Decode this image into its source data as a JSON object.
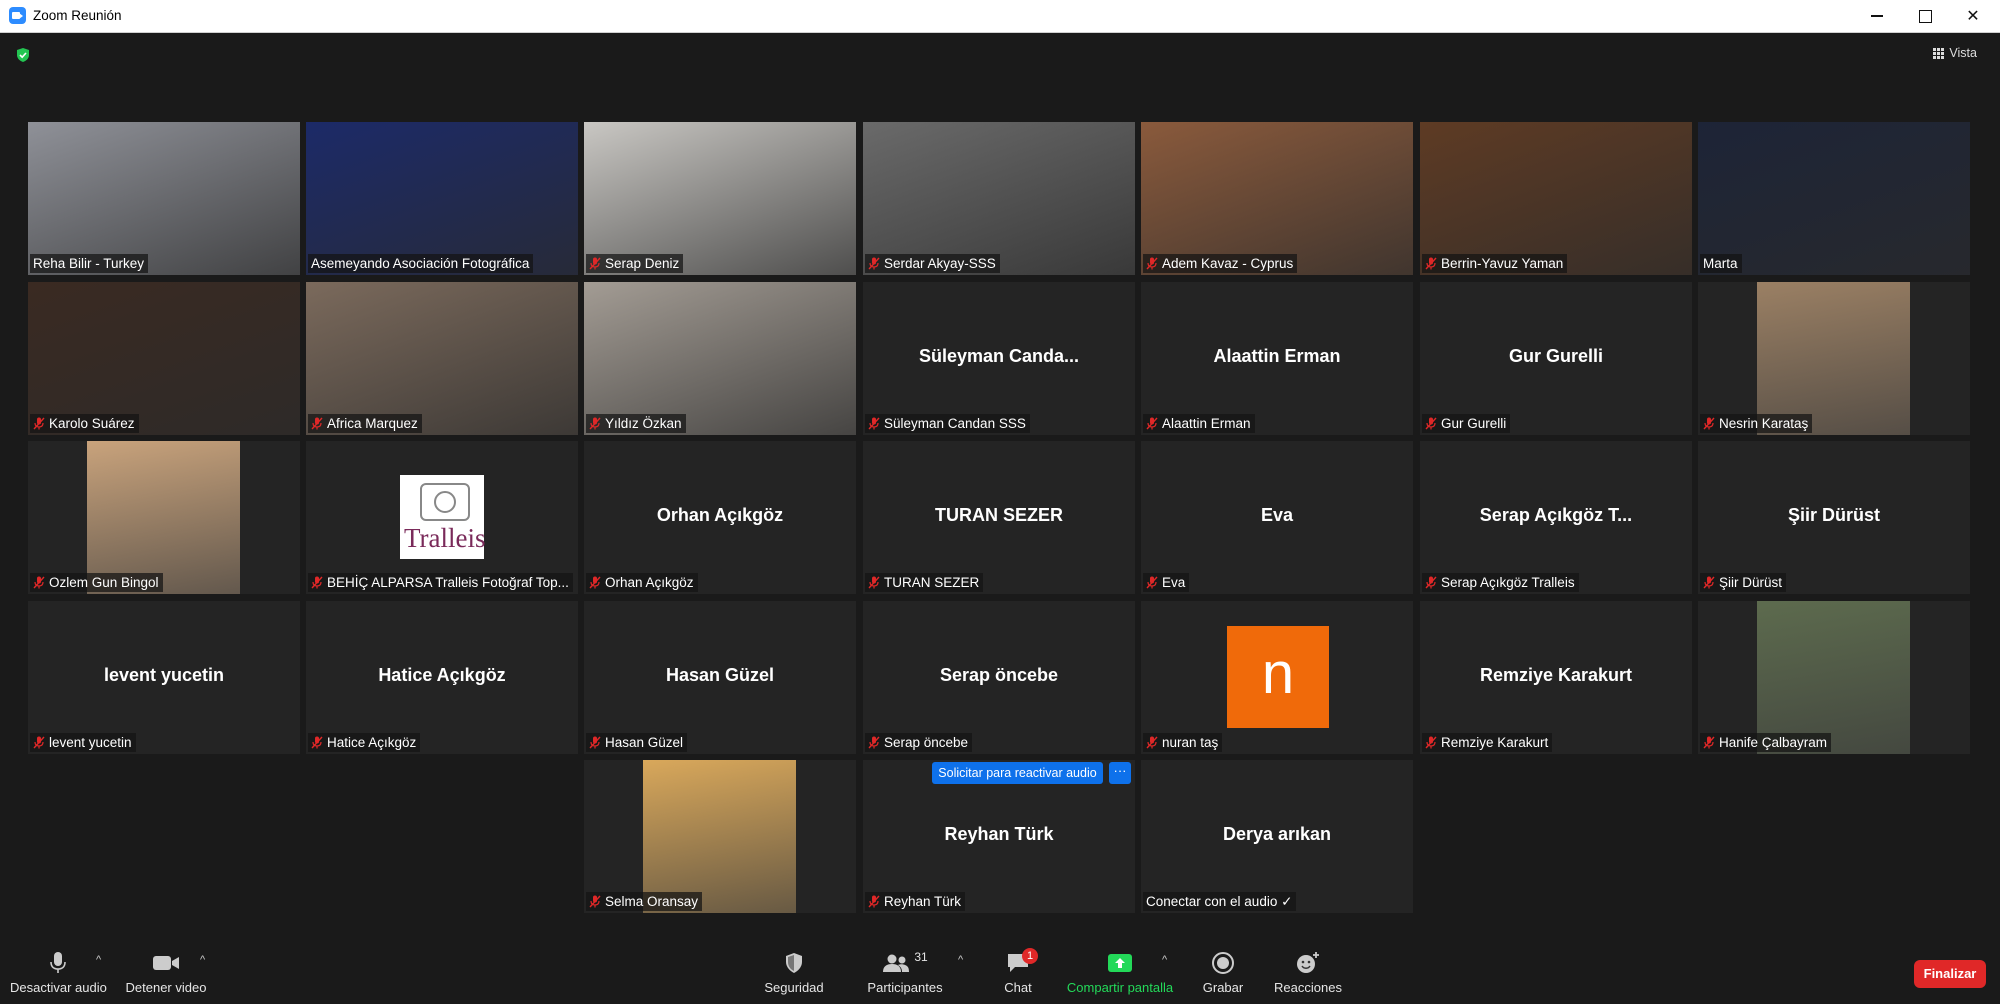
{
  "window": {
    "title": "Zoom Reunión"
  },
  "topbar": {
    "view_label": "Vista"
  },
  "gallery": {
    "tiles": [
      {
        "label": "Reha Bilir - Turkey",
        "muted": false,
        "display": "video",
        "bg": "#8f9198"
      },
      {
        "label": "Asemeyando Asociación Fotográfica",
        "muted": false,
        "display": "video",
        "bg": "#1c2a68"
      },
      {
        "label": "Serap Deniz",
        "muted": true,
        "display": "video",
        "bg": "#c9c7c3"
      },
      {
        "label": "Serdar Akyay-SSS",
        "muted": true,
        "display": "video",
        "bg": "#6a6a6a"
      },
      {
        "label": "Adem Kavaz - Cyprus",
        "muted": true,
        "display": "video",
        "bg": "#8a5a3c"
      },
      {
        "label": "Berrin-Yavuz Yaman",
        "muted": true,
        "display": "video",
        "bg": "#5e3b24"
      },
      {
        "label": "Marta",
        "muted": false,
        "display": "video",
        "bg": "#1d2437",
        "active": true
      },
      {
        "label": "Karolo Suárez",
        "muted": true,
        "display": "video",
        "bg": "#3a2a22"
      },
      {
        "label": "Africa Marquez",
        "muted": true,
        "display": "video",
        "bg": "#7b6a5c"
      },
      {
        "label": "Yıldız Özkan",
        "muted": true,
        "display": "video",
        "bg": "#a39c94"
      },
      {
        "label": "Süleyman Candan SSS",
        "muted": true,
        "display": "name",
        "center": "Süleyman  Canda..."
      },
      {
        "label": "Alaattin Erman",
        "muted": true,
        "display": "name",
        "center": "Alaattin Erman"
      },
      {
        "label": "Gur Gurelli",
        "muted": true,
        "display": "name",
        "center": "Gur Gurelli"
      },
      {
        "label": "Nesrin Karataş",
        "muted": true,
        "display": "photo",
        "bg": "#9b8064"
      },
      {
        "label": "Ozlem Gun Bingol",
        "muted": true,
        "display": "photo",
        "bg": "#c9a37c"
      },
      {
        "label": "BEHİÇ ALPARSA   Tralleis Fotoğraf Top...",
        "muted": true,
        "display": "logo",
        "logo_text": "Tralleis"
      },
      {
        "label": "Orhan Açıkgöz",
        "muted": true,
        "display": "name",
        "center": "Orhan Açıkgöz"
      },
      {
        "label": "TURAN SEZER",
        "muted": true,
        "display": "name",
        "center": "TURAN SEZER"
      },
      {
        "label": "Eva",
        "muted": true,
        "display": "name",
        "center": "Eva"
      },
      {
        "label": "Serap Açıkgöz  Tralleis",
        "muted": true,
        "display": "name",
        "center": "Serap Açıkgöz  T..."
      },
      {
        "label": "Şiir Dürüst",
        "muted": true,
        "display": "name",
        "center": "Şiir Dürüst"
      },
      {
        "label": "levent yucetin",
        "muted": true,
        "display": "name",
        "center": "levent yucetin"
      },
      {
        "label": "Hatice Açıkgöz",
        "muted": true,
        "display": "name",
        "center": "Hatice Açıkgöz"
      },
      {
        "label": "Hasan Güzel",
        "muted": true,
        "display": "name",
        "center": "Hasan Güzel"
      },
      {
        "label": "Serap öncebe",
        "muted": true,
        "display": "name",
        "center": "Serap öncebe"
      },
      {
        "label": "nuran taş",
        "muted": true,
        "display": "avatar",
        "initial": "n",
        "avatar_color": "#f06a0a"
      },
      {
        "label": "Remziye Karakurt",
        "muted": true,
        "display": "name",
        "center": "Remziye Karakurt"
      },
      {
        "label": "Hanife Çalbayram",
        "muted": true,
        "display": "photo",
        "bg": "#5d6b4e"
      },
      {
        "label": "Selma Oransay",
        "muted": true,
        "display": "photo",
        "bg": "#d9a85b"
      },
      {
        "label": "Reyhan Türk",
        "muted": true,
        "display": "name",
        "center": "Reyhan Türk"
      },
      {
        "label": "Conectar con el audio ✓",
        "muted": false,
        "display": "name",
        "center": "Derya  arıkan"
      }
    ],
    "unmute_request": "Solicitar para reactivar audio",
    "unmute_more": "···"
  },
  "toolbar": {
    "mute_label": "Desactivar audio",
    "video_label": "Detener video",
    "security_label": "Seguridad",
    "participants_label": "Participantes",
    "participants_count": "31",
    "chat_label": "Chat",
    "chat_badge": "1",
    "share_label": "Compartir pantalla",
    "record_label": "Grabar",
    "reactions_label": "Reacciones",
    "end_label": "Finalizar"
  },
  "colors": {
    "accent": "#0e71eb",
    "share": "#23d959",
    "end": "#e02828",
    "active_speaker": "#c5d86d"
  }
}
